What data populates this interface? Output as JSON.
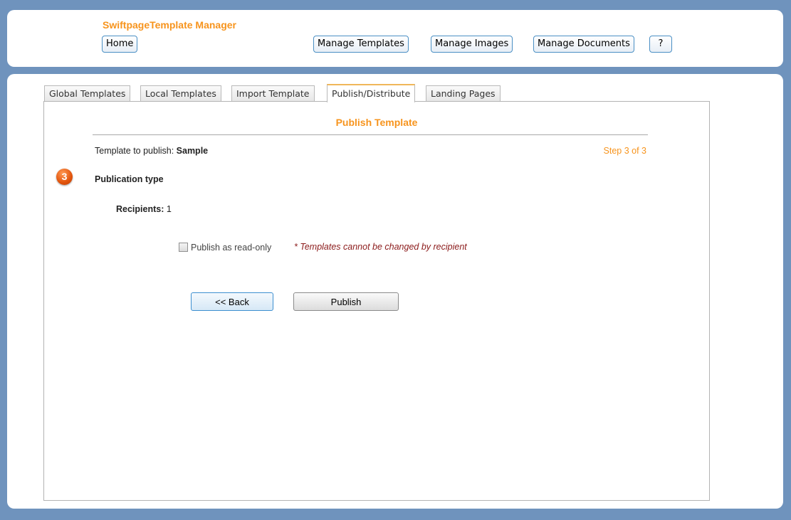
{
  "header": {
    "app_title": "SwiftpageTemplate Manager",
    "home_label": "Home",
    "manage_templates_label": "Manage Templates",
    "manage_images_label": "Manage Images",
    "manage_documents_label": "Manage Documents",
    "help_label": "?"
  },
  "tabs": [
    {
      "label": "Global Templates"
    },
    {
      "label": "Local Templates"
    },
    {
      "label": "Import Template"
    },
    {
      "label": "Publish/Distribute",
      "active": true
    },
    {
      "label": "Landing Pages"
    }
  ],
  "publish": {
    "section_title": "Publish Template",
    "template_label": "Template to publish: ",
    "template_name": "Sample",
    "step_text": "Step 3 of 3",
    "step_number": "3",
    "publication_type_label": "Publication type",
    "recipients_label": "Recipients:",
    "recipients_value": "1",
    "readonly_label": "Publish as read-only",
    "readonly_checked": false,
    "readonly_note": "* Templates cannot be changed by recipient",
    "back_label": "<< Back",
    "publish_label": "Publish"
  },
  "colors": {
    "accent": "#f7941d",
    "background": "#6f93bd",
    "note": "#8b1a1a"
  }
}
